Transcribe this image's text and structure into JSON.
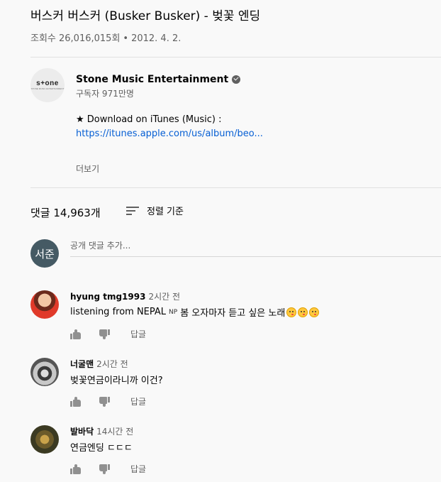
{
  "video": {
    "title": "버스커 버스커 (Busker Busker) - 벚꽃 엔딩",
    "views": "조회수 26,016,015회",
    "separator": "•",
    "date": "2012. 4. 2."
  },
  "channel": {
    "logo_text": "s+one",
    "logo_subtext": "STONE MUSIC ENTERTAINMENT",
    "name": "Stone Music Entertainment",
    "subscribers": "구독자 971만명",
    "verified_icon": "verified-check-icon"
  },
  "description": {
    "line1": "★ Download on iTunes (Music) :",
    "link": "https://itunes.apple.com/us/album/beo...",
    "more": "더보기"
  },
  "comments_header": {
    "count": "댓글 14,963개",
    "sort_label": "정렬 기준",
    "sort_icon": "sort-icon"
  },
  "add_comment": {
    "avatar_text": "서준",
    "placeholder": "공개 댓글 추가..."
  },
  "comments": [
    {
      "author": "hyung tmg1993",
      "time": "2시간 전",
      "text_before": "listening from NEPAL",
      "flag": "NP",
      "text_after": "봄 오자마자 듣고 싶은 노래",
      "reply": "답글"
    },
    {
      "author": "너굴맨",
      "time": "2시간 전",
      "text": "벚꽃연금이라니까 이건?",
      "reply": "답글"
    },
    {
      "author": "발바닥",
      "time": "14시간 전",
      "text": "연금엔딩 ㄷㄷㄷ",
      "reply": "답글"
    }
  ]
}
